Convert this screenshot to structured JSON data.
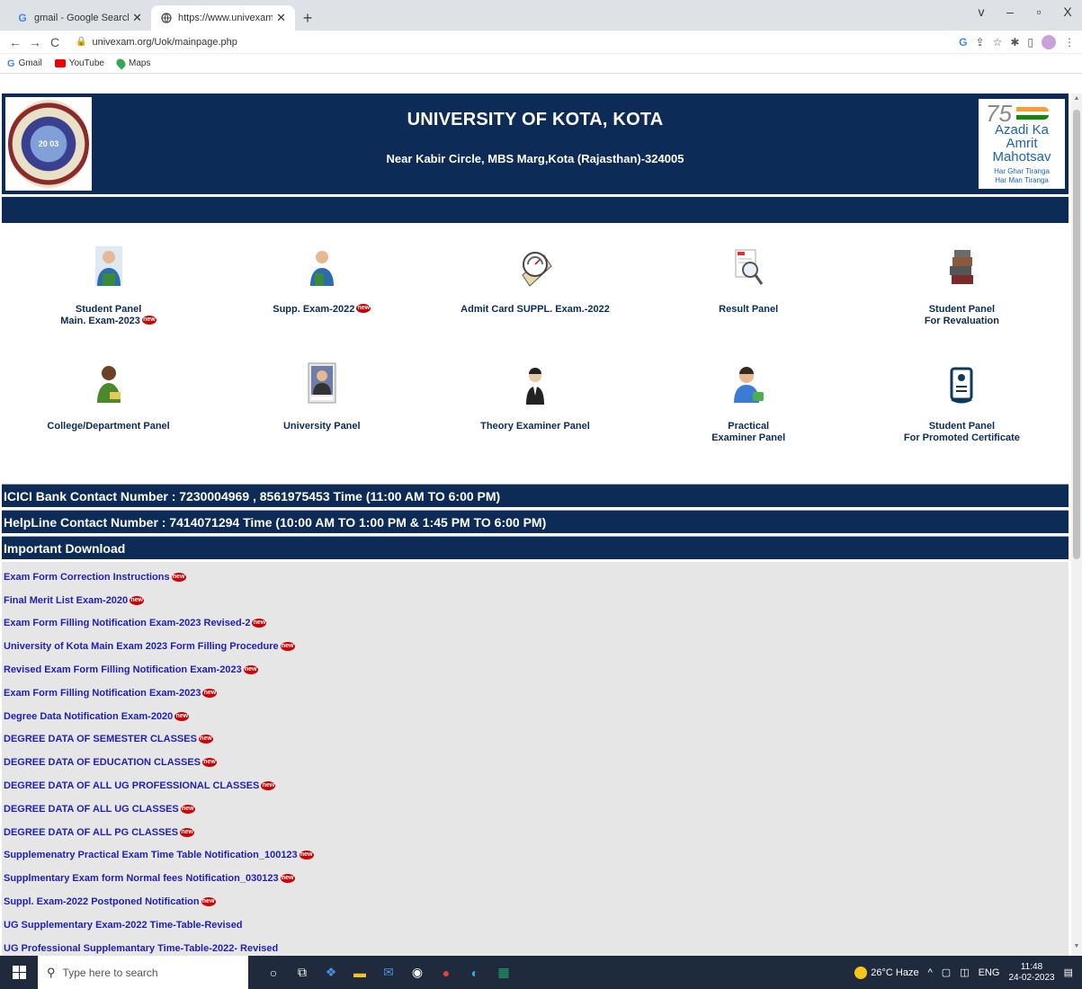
{
  "browser": {
    "tabs": [
      {
        "title": "gmail - Google Search",
        "favicon": "G",
        "active": false
      },
      {
        "title": "https://www.univexam.org/Uok/",
        "favicon": "globe",
        "active": true
      }
    ],
    "new_tab": "+",
    "window_controls": [
      "v",
      "–",
      "▫",
      "X"
    ],
    "url": "univexam.org/Uok/mainpage.php",
    "bookmarks": [
      {
        "label": "Gmail",
        "icon": "google-icon"
      },
      {
        "label": "YouTube",
        "icon": "youtube-icon"
      },
      {
        "label": "Maps",
        "icon": "maps-icon"
      }
    ]
  },
  "header": {
    "title": "UNIVERSITY OF KOTA, KOTA",
    "address": "Near Kabir Circle, MBS Marg,Kota (Rajasthan)-324005",
    "right_logo": {
      "line1": "Azadi Ka",
      "line2": "Amrit Mahotsav",
      "sub1": "Har Ghar Tiranga",
      "sub2": "Har Man Tiranga"
    }
  },
  "panels": [
    {
      "line1": "Student Panel",
      "line2": "Main. Exam-2023",
      "new": true,
      "icon": "student-icon"
    },
    {
      "line1": "Supp. Exam-2022",
      "line2": "",
      "new": true,
      "icon": "student-supp-icon"
    },
    {
      "line1": "Admit Card SUPPL. Exam.-2022",
      "line2": "",
      "new": false,
      "icon": "admit-card-icon"
    },
    {
      "line1": "Result Panel",
      "line2": "",
      "new": false,
      "icon": "result-icon"
    },
    {
      "line1": "Student Panel",
      "line2": "For Revaluation",
      "new": false,
      "icon": "books-icon"
    },
    {
      "line1": "College/Department Panel",
      "line2": "",
      "new": false,
      "icon": "college-icon"
    },
    {
      "line1": "University Panel",
      "line2": "",
      "new": false,
      "icon": "admin-login-icon"
    },
    {
      "line1": "Theory Examiner Panel",
      "line2": "",
      "new": false,
      "icon": "examiner-icon"
    },
    {
      "line1": "Practical",
      "line2": "Examiner Panel",
      "new": false,
      "icon": "practical-icon"
    },
    {
      "line1": "Student Panel",
      "line2": "For Promoted Certificate",
      "new": false,
      "icon": "certificate-icon"
    }
  ],
  "new_badge": "new",
  "info": {
    "icici": "ICICI Bank Contact Number : 7230004969 , 8561975453 Time (11:00 AM TO 6:00 PM)",
    "helpline": "HelpLine Contact Number : 7414071294 Time (10:00 AM TO 1:00 PM & 1:45 PM TO 6:00 PM)",
    "downloads_title": "Important Download"
  },
  "downloads": [
    {
      "label": "Exam Form Correction Instructions",
      "new": true
    },
    {
      "label": "Final Merit List Exam-2020",
      "new": true
    },
    {
      "label": "Exam Form Filling Notification Exam-2023 Revised-2",
      "new": true
    },
    {
      "label": "University of Kota Main Exam 2023 Form Filling Procedure",
      "new": true
    },
    {
      "label": "Revised Exam Form Filling Notification Exam-2023",
      "new": true
    },
    {
      "label": "Exam Form Filling Notification Exam-2023",
      "new": true
    },
    {
      "label": "Degree Data Notification Exam-2020",
      "new": true
    },
    {
      "label": "DEGREE DATA OF SEMESTER CLASSES",
      "new": true
    },
    {
      "label": "DEGREE DATA OF EDUCATION CLASSES",
      "new": true
    },
    {
      "label": "DEGREE DATA OF ALL UG PROFESSIONAL CLASSES",
      "new": true
    },
    {
      "label": "DEGREE DATA OF ALL UG CLASSES",
      "new": true
    },
    {
      "label": "DEGREE DATA OF ALL PG CLASSES",
      "new": true
    },
    {
      "label": "Supplemenatry Practical Exam Time Table Notification_100123",
      "new": true
    },
    {
      "label": "Supplmentary Exam form Normal fees Notification_030123",
      "new": true
    },
    {
      "label": "Suppl. Exam-2022 Postponed Notification",
      "new": true
    },
    {
      "label": "UG Supplementary Exam-2022 Time-Table-Revised",
      "new": false
    },
    {
      "label": "UG Professional Supplemantary Time-Table-2022- Revised",
      "new": false
    }
  ],
  "taskbar": {
    "search_placeholder": "Type here to search",
    "weather": "26°C Haze",
    "lang": "ENG",
    "time": "11:48",
    "date": "24-02-2023"
  }
}
